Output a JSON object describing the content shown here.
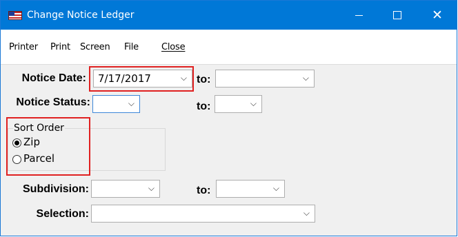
{
  "window": {
    "title": "Change Notice Ledger",
    "icon": "flag-icon",
    "controls": {
      "minimize": "minimize",
      "maximize": "maximize",
      "close": "close"
    }
  },
  "menu": {
    "items": [
      "Printer",
      "Print",
      "Screen",
      "File",
      "Close"
    ]
  },
  "form": {
    "notice_date": {
      "label": "Notice Date:",
      "value": "7/17/2017",
      "to_label": "to:",
      "to_value": ""
    },
    "notice_status": {
      "label": "Notice Status:",
      "value": "",
      "to_label": "to:",
      "to_value": ""
    },
    "sort_order": {
      "title": "Sort Order",
      "options": [
        {
          "label": "Zip",
          "checked": true
        },
        {
          "label": "Parcel",
          "checked": false
        }
      ]
    },
    "subdivision": {
      "label": "Subdivision:",
      "value": "",
      "to_label": "to:",
      "to_value": ""
    },
    "selection": {
      "label": "Selection:",
      "value": ""
    }
  },
  "colors": {
    "titlebar": "#0078d7",
    "highlight_box": "#e02020"
  }
}
